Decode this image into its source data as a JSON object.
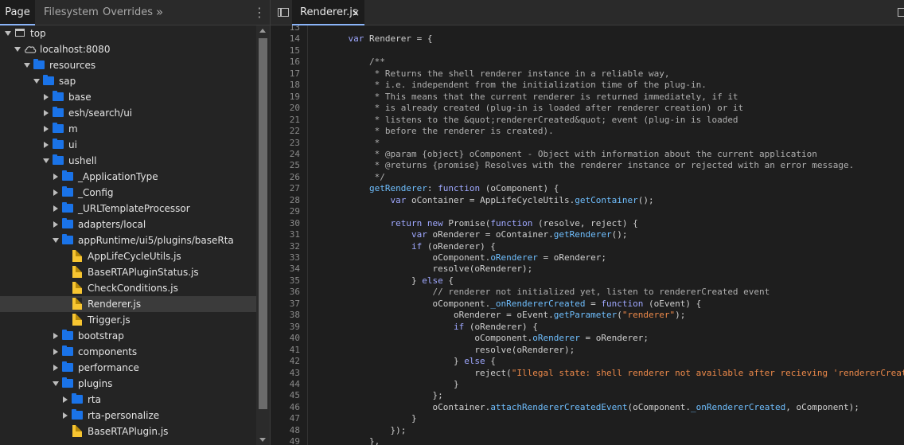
{
  "sources_panel": {
    "tabs": [
      "Page",
      "Filesystem",
      "Overrides"
    ],
    "more_tabs_icon": "double-chevron-right",
    "menu_icon": "kebab-vertical"
  },
  "file_tree": [
    {
      "label": "top",
      "icon": "frame",
      "expanded": true
    },
    {
      "label": "localhost:8080",
      "icon": "cloud",
      "expanded": true
    },
    {
      "label": "resources",
      "icon": "folder",
      "expanded": true
    },
    {
      "label": "sap",
      "icon": "folder",
      "expanded": true
    },
    {
      "label": "base",
      "icon": "folder",
      "expanded": false
    },
    {
      "label": "esh/search/ui",
      "icon": "folder",
      "expanded": false
    },
    {
      "label": "m",
      "icon": "folder",
      "expanded": false
    },
    {
      "label": "ui",
      "icon": "folder",
      "expanded": false
    },
    {
      "label": "ushell",
      "icon": "folder",
      "expanded": true
    },
    {
      "label": "_ApplicationType",
      "icon": "folder",
      "expanded": false
    },
    {
      "label": "_Config",
      "icon": "folder",
      "expanded": false
    },
    {
      "label": "_URLTemplateProcessor",
      "icon": "folder",
      "expanded": false
    },
    {
      "label": "adapters/local",
      "icon": "folder",
      "expanded": false
    },
    {
      "label": "appRuntime/ui5/plugins/baseRta",
      "icon": "folder",
      "expanded": true
    },
    {
      "label": "AppLifeCycleUtils.js",
      "icon": "file",
      "expanded": null
    },
    {
      "label": "BaseRTAPluginStatus.js",
      "icon": "file",
      "expanded": null
    },
    {
      "label": "CheckConditions.js",
      "icon": "file",
      "expanded": null
    },
    {
      "label": "Renderer.js",
      "icon": "file",
      "expanded": null,
      "selected": true
    },
    {
      "label": "Trigger.js",
      "icon": "file",
      "expanded": null
    },
    {
      "label": "bootstrap",
      "icon": "folder",
      "expanded": false
    },
    {
      "label": "components",
      "icon": "folder",
      "expanded": false
    },
    {
      "label": "performance",
      "icon": "folder",
      "expanded": false
    },
    {
      "label": "plugins",
      "icon": "folder",
      "expanded": true
    },
    {
      "label": "rta",
      "icon": "folder",
      "expanded": false
    },
    {
      "label": "rta-personalize",
      "icon": "folder",
      "expanded": false
    },
    {
      "label": "BaseRTAPlugin.js",
      "icon": "file",
      "expanded": null
    }
  ],
  "editor": {
    "open_tab": "Renderer.js",
    "close_glyph": "×",
    "first_line_number": 13,
    "lines": [
      [
        [
          "p",
          ""
        ]
      ],
      [
        [
          "p",
          "    "
        ],
        [
          "k",
          "var"
        ],
        [
          "p",
          " Renderer = {"
        ]
      ],
      [
        [
          "p",
          ""
        ]
      ],
      [
        [
          "c",
          "        /**"
        ]
      ],
      [
        [
          "c",
          "         * Returns the shell renderer instance in a reliable way,"
        ]
      ],
      [
        [
          "c",
          "         * i.e. independent from the initialization time of the plug-in."
        ]
      ],
      [
        [
          "c",
          "         * This means that the current renderer is returned immediately, if it"
        ]
      ],
      [
        [
          "c",
          "         * is already created (plug-in is loaded after renderer creation) or it"
        ]
      ],
      [
        [
          "c",
          "         * listens to the &quot;rendererCreated&quot; event (plug-in is loaded"
        ]
      ],
      [
        [
          "c",
          "         * before the renderer is created)."
        ]
      ],
      [
        [
          "c",
          "         *"
        ]
      ],
      [
        [
          "c",
          "         * @param {object} oComponent - Object with information about the current application"
        ]
      ],
      [
        [
          "c",
          "         * @returns {promise} Resolves with the renderer instance or rejected with an error message."
        ]
      ],
      [
        [
          "c",
          "         */"
        ]
      ],
      [
        [
          "p",
          "        "
        ],
        [
          "m",
          "getRenderer"
        ],
        [
          "p",
          ": "
        ],
        [
          "k",
          "function"
        ],
        [
          "p",
          " (oComponent) {"
        ]
      ],
      [
        [
          "p",
          "            "
        ],
        [
          "k",
          "var"
        ],
        [
          "p",
          " oContainer = AppLifeCycleUtils."
        ],
        [
          "m",
          "getContainer"
        ],
        [
          "p",
          "();"
        ]
      ],
      [
        [
          "p",
          ""
        ]
      ],
      [
        [
          "p",
          "            "
        ],
        [
          "k",
          "return"
        ],
        [
          "p",
          " "
        ],
        [
          "k",
          "new"
        ],
        [
          "p",
          " Promise("
        ],
        [
          "k",
          "function"
        ],
        [
          "p",
          " (resolve, reject) {"
        ]
      ],
      [
        [
          "p",
          "                "
        ],
        [
          "k",
          "var"
        ],
        [
          "p",
          " oRenderer = oContainer."
        ],
        [
          "m",
          "getRenderer"
        ],
        [
          "p",
          "();"
        ]
      ],
      [
        [
          "p",
          "                "
        ],
        [
          "k",
          "if"
        ],
        [
          "p",
          " (oRenderer) {"
        ]
      ],
      [
        [
          "p",
          "                    oComponent."
        ],
        [
          "m",
          "oRenderer"
        ],
        [
          "p",
          " = oRenderer;"
        ]
      ],
      [
        [
          "p",
          "                    resolve(oRenderer);"
        ]
      ],
      [
        [
          "p",
          "                } "
        ],
        [
          "k",
          "else"
        ],
        [
          "p",
          " {"
        ]
      ],
      [
        [
          "c",
          "                    // renderer not initialized yet, listen to rendererCreated event"
        ]
      ],
      [
        [
          "p",
          "                    oComponent."
        ],
        [
          "m",
          "_onRendererCreated"
        ],
        [
          "p",
          " = "
        ],
        [
          "k",
          "function"
        ],
        [
          "p",
          " (oEvent) {"
        ]
      ],
      [
        [
          "p",
          "                        oRenderer = oEvent."
        ],
        [
          "m",
          "getParameter"
        ],
        [
          "p",
          "("
        ],
        [
          "s",
          "\"renderer\""
        ],
        [
          "p",
          ");"
        ]
      ],
      [
        [
          "p",
          "                        "
        ],
        [
          "k",
          "if"
        ],
        [
          "p",
          " (oRenderer) {"
        ]
      ],
      [
        [
          "p",
          "                            oComponent."
        ],
        [
          "m",
          "oRenderer"
        ],
        [
          "p",
          " = oRenderer;"
        ]
      ],
      [
        [
          "p",
          "                            resolve(oRenderer);"
        ]
      ],
      [
        [
          "p",
          "                        } "
        ],
        [
          "k",
          "else"
        ],
        [
          "p",
          " {"
        ]
      ],
      [
        [
          "p",
          "                            reject("
        ],
        [
          "s",
          "\"Illegal state: shell renderer not available after recieving 'rendererCreated' event.\""
        ],
        [
          "p",
          ");"
        ]
      ],
      [
        [
          "p",
          "                        }"
        ]
      ],
      [
        [
          "p",
          "                    };"
        ]
      ],
      [
        [
          "p",
          "                    oContainer."
        ],
        [
          "m",
          "attachRendererCreatedEvent"
        ],
        [
          "p",
          "(oComponent."
        ],
        [
          "m",
          "_onRendererCreated"
        ],
        [
          "p",
          ", oComponent);"
        ]
      ],
      [
        [
          "p",
          "                }"
        ]
      ],
      [
        [
          "p",
          "            });"
        ]
      ],
      [
        [
          "p",
          "        },"
        ]
      ]
    ]
  }
}
